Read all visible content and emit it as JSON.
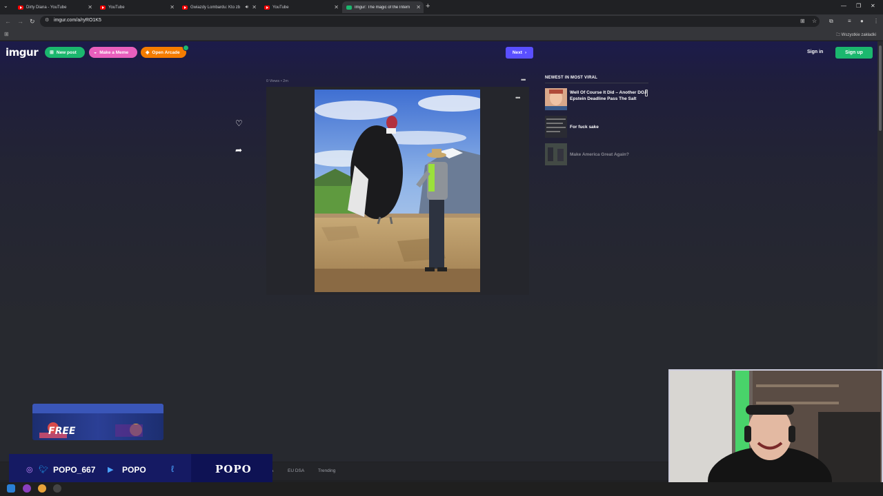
{
  "browser": {
    "tabs": [
      {
        "title": "Dirty Diana - YouTube",
        "favicon": "youtube-icon",
        "active": false
      },
      {
        "title": "YouTube",
        "favicon": "youtube-icon",
        "active": false
      },
      {
        "title": "Gwiazdy Lombardu: Kto zb",
        "favicon": "youtube-icon",
        "active": false,
        "audio": true
      },
      {
        "title": "YouTube",
        "favicon": "youtube-icon",
        "active": false
      },
      {
        "title": "Imgur: The magic of the Intern",
        "favicon": "imgur-icon",
        "active": true
      }
    ],
    "url": "imgur.com/a/ryRO1K5",
    "bookmarks_folder": "Wszystkie zakładki"
  },
  "imgur": {
    "logo": "imgur",
    "nav": {
      "new_post": "New post",
      "make_meme": "Make a Meme",
      "open_arcade": "Open Arcade",
      "next": "Next",
      "sign_in": "Sign in",
      "sign_up": "Sign up"
    },
    "colors": {
      "green": "#1bb76e",
      "pink": "#e85fbd",
      "orange": "#f57c00",
      "next_blue": "#5a4fff"
    },
    "post": {
      "views": "0 Views",
      "age": "2m",
      "separator": "•"
    },
    "sidebar": {
      "title": "NEWEST IN MOST VIRAL",
      "items": [
        {
          "title": "Well Of Course It Did – Another DOJ Epstein Deadline Pass The Salt"
        },
        {
          "title": "For fuck sake"
        },
        {
          "title": "Make America Great Again?"
        }
      ]
    },
    "footer": {
      "links": [
        "EU DSA",
        "Trending"
      ],
      "partial_link": "A"
    }
  },
  "overlay": {
    "promo_text": "FREE",
    "social_handle_1": "POPO_667",
    "social_handle_2": "POPO",
    "brand": "POPO"
  }
}
